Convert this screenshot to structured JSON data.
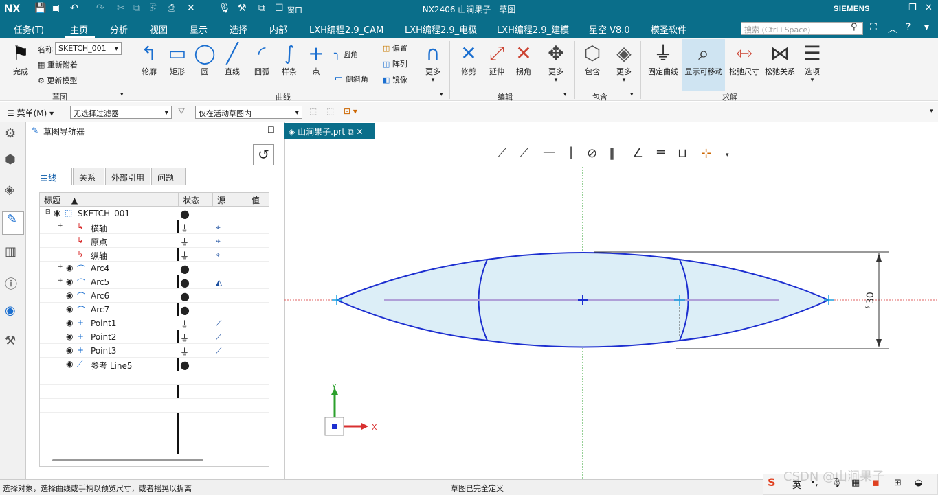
{
  "titlebar": {
    "logo": "NX",
    "title": "NX2406 山涧果子 - 草图",
    "brand": "SIEMENS",
    "window_menu": "窗口"
  },
  "menu": {
    "tabs": [
      "任务(T)",
      "主页",
      "分析",
      "视图",
      "显示",
      "选择",
      "内部",
      "LXH编程2.9_CAM",
      "LXH编程2.9_电极",
      "LXH编程2.9_建模",
      "星空 V8.0",
      "模圣软件"
    ],
    "active": "主页",
    "search_placeholder": "搜索 (Ctrl+Space)"
  },
  "ribbon": {
    "sketch": {
      "finish": "完成",
      "name_label": "名称",
      "name_value": "SKETCH_001",
      "reattach": "重新附着",
      "update": "更新模型",
      "group": "草图"
    },
    "curve": {
      "items": [
        "轮廓",
        "矩形",
        "圆",
        "直线",
        "圆弧",
        "样条",
        "点"
      ],
      "fillet": "圆角",
      "chamfer": "倒斜角",
      "offset": "偏置",
      "pattern": "阵列",
      "mirror": "镜像",
      "more": "更多",
      "group": "曲线"
    },
    "edit": {
      "items": [
        "修剪",
        "延伸",
        "拐角",
        "更多"
      ],
      "group": "编辑"
    },
    "include": {
      "items": [
        "包含",
        "更多"
      ],
      "group": "包含"
    },
    "solve": {
      "items": [
        "固定曲线",
        "显示可移动",
        "松弛尺寸",
        "松弛关系",
        "选项"
      ],
      "group": "求解"
    }
  },
  "filterbar": {
    "menu": "菜单(M)",
    "filter": "无选择过滤器",
    "scope": "仅在活动草图内"
  },
  "navigator": {
    "title": "草图导航器",
    "tabs": [
      "曲线",
      "关系",
      "外部引用",
      "问题"
    ],
    "columns": [
      "标题",
      "状态",
      "源",
      "值"
    ],
    "rows": [
      {
        "name": "SKETCH_001",
        "state": "●",
        "src": ""
      },
      {
        "name": "横轴",
        "state": "⏚",
        "src": "⌖"
      },
      {
        "name": "原点",
        "state": "⏚",
        "src": "⌖"
      },
      {
        "name": "纵轴",
        "state": "⏚",
        "src": "⌖"
      },
      {
        "name": "Arc4",
        "state": "●",
        "src": ""
      },
      {
        "name": "Arc5",
        "state": "●",
        "src": "◭"
      },
      {
        "name": "Arc6",
        "state": "●",
        "src": ""
      },
      {
        "name": "Arc7",
        "state": "●",
        "src": ""
      },
      {
        "name": "Point1",
        "state": "⏚",
        "src": "⟋"
      },
      {
        "name": "Point2",
        "state": "⏚",
        "src": "⟋"
      },
      {
        "name": "Point3",
        "state": "⏚",
        "src": "⟋"
      },
      {
        "name": "参考 Line5",
        "state": "●",
        "src": ""
      }
    ]
  },
  "viewport": {
    "tab": "山涧果子.prt",
    "dimension": "30",
    "axis_x": "X",
    "axis_y": "Y"
  },
  "status": {
    "left": "选择对象，选择曲线或手柄以预览尺寸，或者摇晃以拆离",
    "center": "草图已完全定义",
    "watermark": "CSDN @山涧果子",
    "ime": "英"
  },
  "colors": {
    "header": "#0a6e8a",
    "curve": "#1d2fd0",
    "fill": "#dceef7"
  }
}
